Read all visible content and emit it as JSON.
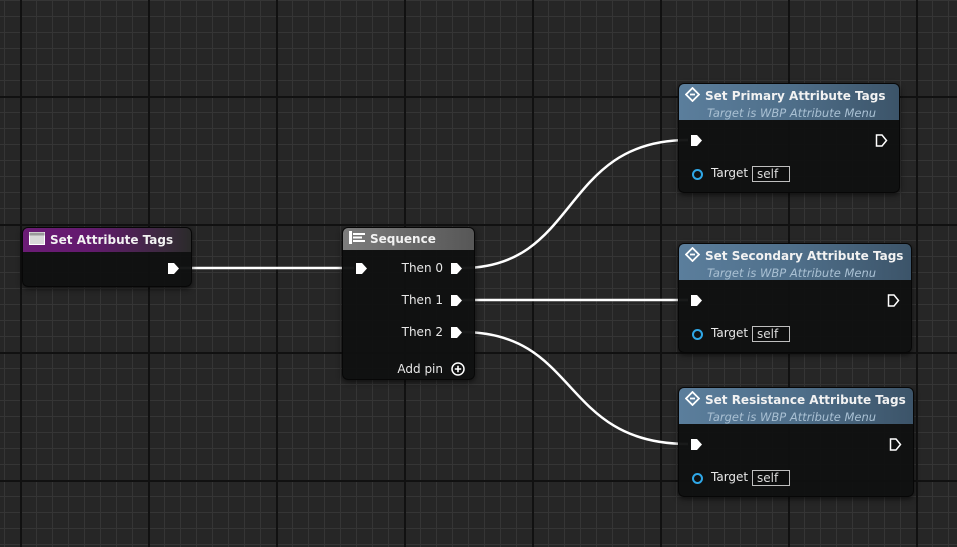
{
  "nodes": {
    "event": {
      "title": "Set Attribute Tags"
    },
    "sequence": {
      "title": "Sequence",
      "then0": "Then 0",
      "then1": "Then 1",
      "then2": "Then 2",
      "add_pin": "Add pin"
    },
    "set_primary": {
      "title": "Set Primary Attribute Tags",
      "subtitle": "Target is WBP Attribute Menu",
      "target_label": "Target",
      "target_value": "self"
    },
    "set_secondary": {
      "title": "Set Secondary Attribute Tags",
      "subtitle": "Target is WBP Attribute Menu",
      "target_label": "Target",
      "target_value": "self"
    },
    "set_resistance": {
      "title": "Set Resistance Attribute Tags",
      "subtitle": "Target is WBP Attribute Menu",
      "target_label": "Target",
      "target_value": "self"
    }
  },
  "colors": {
    "event_header": "#6b1c75",
    "sequence_header": "#7d7d7d",
    "function_header": "#5b7e9c",
    "exec_wire": "#ffffff",
    "object_pin": "#2fa8e8",
    "graph_background": "#262626"
  },
  "icons": {
    "event": "event-node-icon",
    "sequence": "sequence-icon",
    "function": "function-icon",
    "add_pin": "plus-circle-icon"
  }
}
